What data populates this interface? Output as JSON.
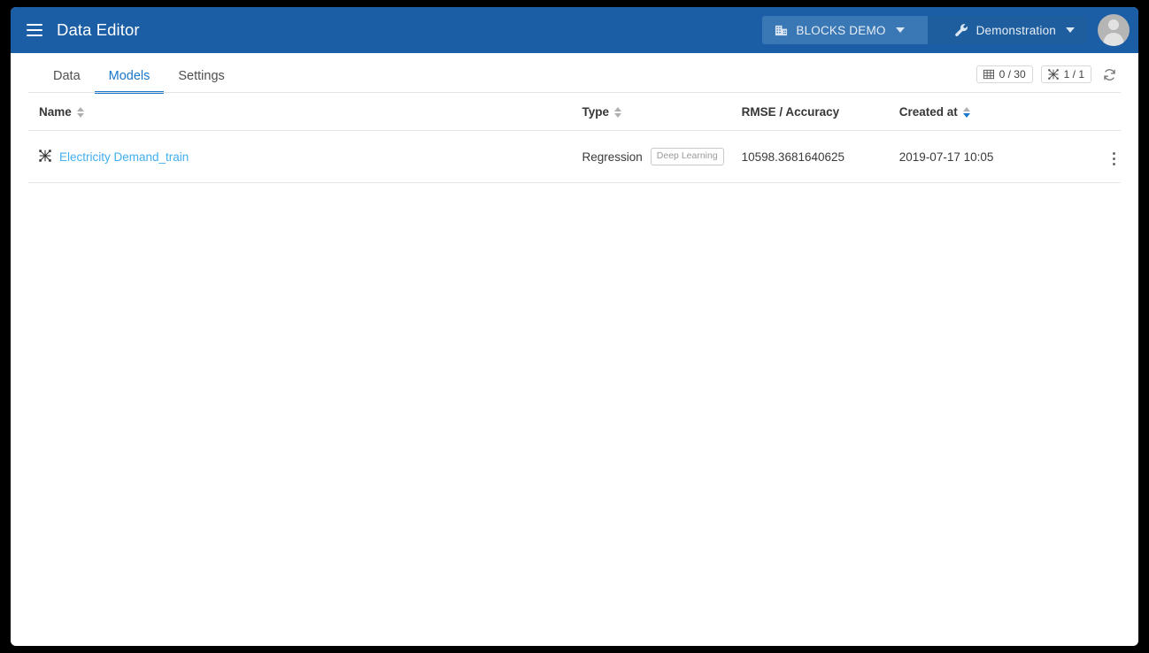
{
  "window": {
    "app_title": "Data Editor"
  },
  "header": {
    "menu_icon": "hamburger-icon",
    "breadcrumbs": [
      {
        "label": "BLOCKS DEMO",
        "icon": "building-icon",
        "caret": "chevron-down-icon"
      },
      {
        "label": "Demonstration",
        "icon": "wrench-icon",
        "caret": "chevron-down-icon"
      }
    ],
    "avatar": "user-avatar-icon"
  },
  "tabs": [
    {
      "label": "Data",
      "active": false
    },
    {
      "label": "Models",
      "active": true
    },
    {
      "label": "Settings",
      "active": false
    }
  ],
  "toolbar": {
    "datasets_counter": {
      "icon": "table-grid-icon",
      "value": "0 / 30"
    },
    "models_counter": {
      "icon": "model-network-icon",
      "value": "1 / 1"
    },
    "refresh": {
      "icon": "refresh-icon",
      "label": "Refresh"
    }
  },
  "table": {
    "columns": [
      {
        "label": "Name",
        "sortable": true,
        "sort_state": "none"
      },
      {
        "label": "Type",
        "sortable": true,
        "sort_state": "none"
      },
      {
        "label": "RMSE / Accuracy",
        "sortable": false,
        "sort_state": "none"
      },
      {
        "label": "Created at",
        "sortable": true,
        "sort_state": "desc"
      }
    ],
    "rows": [
      {
        "icon": "model-network-icon",
        "name": "Electricity Demand_train",
        "type": "Regression",
        "type_badge": "Deep Learning",
        "rmse_accuracy": "10598.3681640625",
        "created_at": "2019-07-17 10:05",
        "menu_icon": "kebab-menu-icon"
      }
    ]
  },
  "colors": {
    "appbar": "#1b5ea6",
    "crumb_light": "#3a77b5",
    "crumb_dark": "#1f5e9e",
    "accent": "#1976c8",
    "link": "#42aeee",
    "page_bg": "#ffffff",
    "outer_bg": "#000000"
  }
}
